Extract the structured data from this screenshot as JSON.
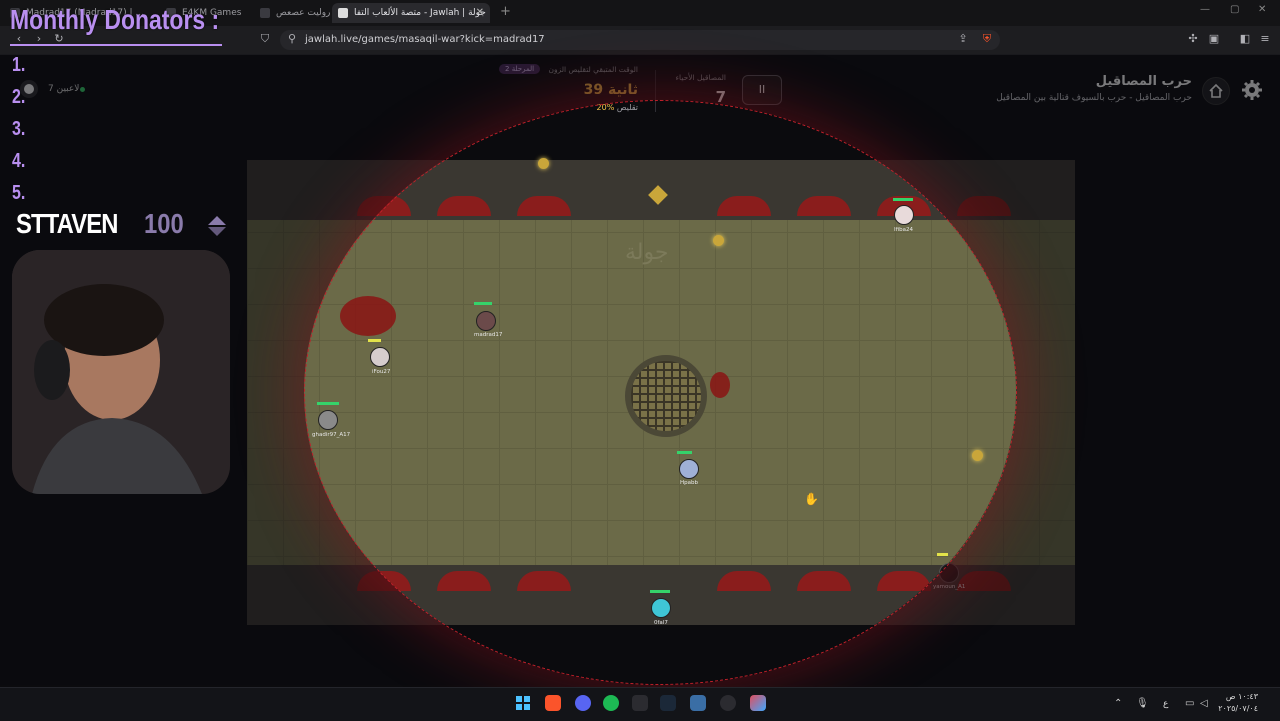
{
  "browser": {
    "tabs": [
      {
        "label": "Madrad17 (Madrad17) | ..."
      },
      {
        "label": "E4KM Games"
      },
      {
        "label": "روليت عصعص"
      },
      {
        "label": "متصة الألعاب التفا - Jawlah | جولة",
        "active": true
      }
    ],
    "url": "jawlah.live/games/masaqil-war?kick=madrad17"
  },
  "overlay": {
    "donators_title": "Monthly Donators :",
    "ranks": [
      "1.",
      "2.",
      "3.",
      "4.",
      "5."
    ],
    "sub_name": "STTAVEN",
    "sub_count": "100"
  },
  "game": {
    "title": "حرب المصاقيل",
    "subtitle": "حرب المصاقيل - حرب بالسيوف قتالية بين المصاقيل",
    "players_online": "7 لاعبين",
    "alive_label": "المصاقيل الأحياء",
    "alive_count": "7",
    "pause_label": "II",
    "stage_badge": "المرحلة 2",
    "shrink_label": "الوقت المتبقي لتقليص الزون",
    "time_left": "39 ثانية",
    "shrink_pct_value": "20%",
    "shrink_pct_label": "تقليص",
    "watermark": "جولة",
    "players": [
      {
        "name": "Ifiba24",
        "hp": 0.9
      },
      {
        "name": "madrad17",
        "hp": 0.8
      },
      {
        "name": "iFou27",
        "hp": 0.6
      },
      {
        "name": "ghadir97_A17",
        "hp": 1.0
      },
      {
        "name": "Hpabb",
        "hp": 0.7
      },
      {
        "name": "yamoun_A1",
        "hp": 0.5
      },
      {
        "name": "0fal7",
        "hp": 0.9
      }
    ]
  },
  "taskbar": {
    "lang": "ع",
    "time": "١٠:٤٣ ص",
    "date": "٢٠٢٥/٠٧/٠٤"
  },
  "colors": {
    "accent_purple": "#b98ff0",
    "zone_red": "#c0202a",
    "gold": "#f2c34a",
    "hp_green": "#35d36a"
  }
}
